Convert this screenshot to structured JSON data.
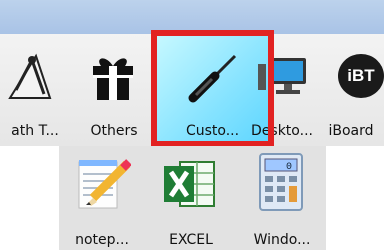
{
  "row1": [
    {
      "name": "math-tools",
      "label": "ath T...",
      "icon": "compass-ruler-icon"
    },
    {
      "name": "others",
      "label": "Others",
      "icon": "gift-icon"
    },
    {
      "name": "customize",
      "label": "Custo...",
      "icon": "screwdriver-icon",
      "selected": true
    },
    {
      "name": "desktop",
      "label": "Deskto...",
      "icon": "monitor-icon"
    },
    {
      "name": "iboard",
      "label": "iBoard",
      "icon": "iboard-logo-icon",
      "logo_text": "iBT"
    }
  ],
  "row2": [
    {
      "name": "notepad",
      "label": "notep...",
      "icon": "notepad-pencil-icon"
    },
    {
      "name": "excel",
      "label": "EXCEL",
      "icon": "excel-icon"
    },
    {
      "name": "windows-calculator",
      "label": "Windo...",
      "icon": "calculator-icon"
    }
  ],
  "colors": {
    "selection_border": "#e22222",
    "selection_fill": "#86e3ff",
    "top_band": "#b4cbe9"
  }
}
